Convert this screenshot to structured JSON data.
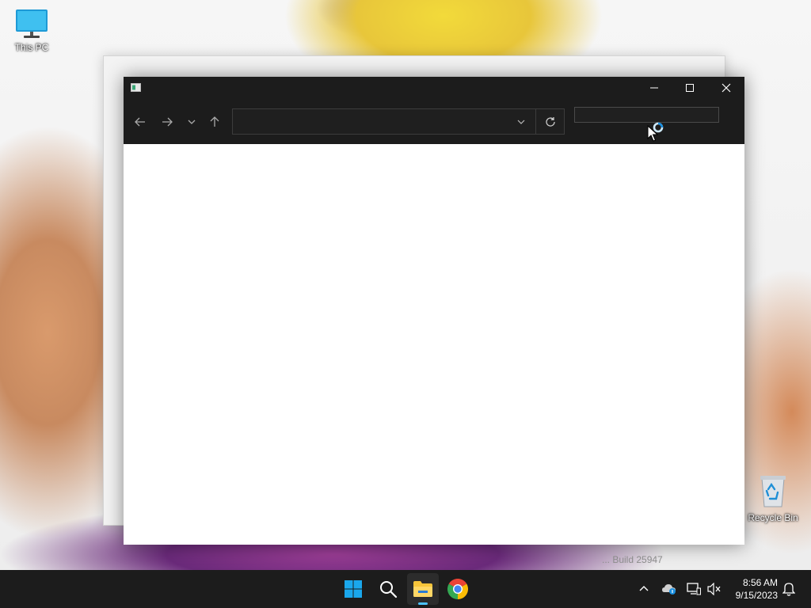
{
  "desktop": {
    "icons": [
      {
        "label": "This PC"
      },
      {
        "label": "Recycle Bin"
      }
    ],
    "watermark": "... Build 25947"
  },
  "explorer": {
    "address": {
      "value": "",
      "placeholder": ""
    },
    "search": {
      "value": "",
      "placeholder": ""
    }
  },
  "taskbar": {
    "apps": [
      "start",
      "search",
      "file-explorer",
      "chrome"
    ],
    "active_app": "file-explorer",
    "clock": {
      "time": "8:56 AM",
      "date": "9/15/2023"
    }
  },
  "colors": {
    "titlebar": "#1c1c1c",
    "taskbar": "#1c1c1c",
    "accent": "#4cc2ff",
    "windows_logo": "#1aa7ec",
    "folder": "#f8c53a"
  }
}
